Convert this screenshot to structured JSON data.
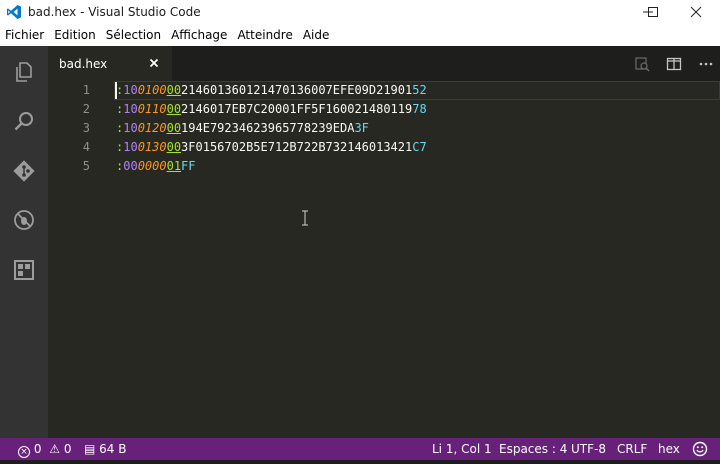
{
  "window": {
    "title": "bad.hex - Visual Studio Code"
  },
  "menu": [
    "Fichier",
    "Edition",
    "Sélection",
    "Affichage",
    "Atteindre",
    "Aide"
  ],
  "activity_icons": [
    "explorer-icon",
    "search-icon",
    "git-icon",
    "debug-icon",
    "extensions-icon"
  ],
  "tab": {
    "label": "bad.hex",
    "close_glyph": "×"
  },
  "editor": {
    "line_numbers": [
      "1",
      "2",
      "3",
      "4",
      "5"
    ],
    "lines": [
      {
        "colon": ":",
        "count": "10",
        "addr": "0100",
        "type": "00",
        "data": "214601360121470136007EFE09D21901",
        "sum": "52"
      },
      {
        "colon": ":",
        "count": "10",
        "addr": "0110",
        "type": "00",
        "data": "2146017EB7C20001FF5F160021480119",
        "sum": "78"
      },
      {
        "colon": ":",
        "count": "10",
        "addr": "0120",
        "type": "00",
        "data": "194E79234623965778239EDA",
        "sum": "3F"
      },
      {
        "colon": ":",
        "count": "10",
        "addr": "0130",
        "type": "00",
        "data": "3F0156702B5E712B722B732146013421",
        "sum": "C7"
      },
      {
        "colon": ":",
        "count": "00",
        "addr": "0000",
        "type": "01",
        "data": "",
        "sum": "FF"
      }
    ]
  },
  "status": {
    "errors": "0",
    "warnings": "0",
    "file_size": "64 B",
    "position": "Li 1, Col 1",
    "indent": "Espaces : 4",
    "encoding": "UTF-8",
    "eol": "CRLF",
    "language": "hex"
  },
  "colors": {
    "status_bar": "#68217a",
    "activity_bar": "#333333",
    "editor_bg": "#272822"
  }
}
